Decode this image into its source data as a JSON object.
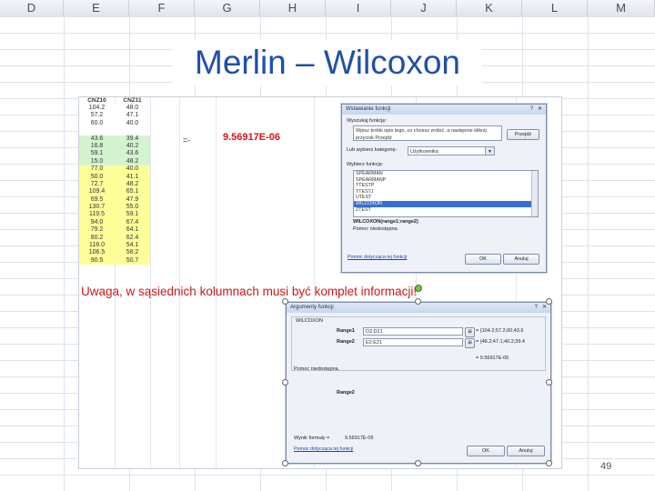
{
  "columns": [
    "D",
    "E",
    "F",
    "G",
    "H",
    "I",
    "J",
    "K",
    "L",
    "M"
  ],
  "title": "Merlin – Wilcoxon",
  "sheet": {
    "headers": [
      "CNZ10",
      "CNZ11"
    ],
    "rows": [
      [
        "104.2",
        "48.0"
      ],
      [
        "57.2",
        "47.1"
      ],
      [
        "60.0",
        "40.0"
      ],
      [
        "",
        ""
      ],
      [
        "43.6",
        "39.4"
      ],
      [
        "16.8",
        "40.2"
      ],
      [
        "59.1",
        "43.6"
      ],
      [
        "15.0",
        "48.2"
      ],
      [
        "77.0",
        "40.0"
      ],
      [
        "50.0",
        "41.1"
      ],
      [
        "72.7",
        "48.2"
      ],
      [
        "109.4",
        "65.1"
      ],
      [
        "69.5",
        "47.9"
      ],
      [
        "130.7",
        "55.0"
      ],
      [
        "119.5",
        "59.1"
      ],
      [
        "94.0",
        "67.4"
      ],
      [
        "79.2",
        "64.1"
      ],
      [
        "80.2",
        "62.4"
      ],
      [
        "118.0",
        "54.1"
      ],
      [
        "106.5",
        "58.2"
      ],
      [
        "90.5",
        "50.7"
      ]
    ],
    "arrow_text": "=-",
    "result_value": "9.56917E-06",
    "warning": "Uwaga, w sąsiednich kolumnach musi być komplet informacji!"
  },
  "dialog1": {
    "title": "Wstawianie funkcji",
    "search_label": "Wyszukaj funkcję:",
    "search_value": "Wpisz krótki opis tego, co chcesz zrobić, a następnie kliknij przycisk Przejdź",
    "go_button": "Przejdź",
    "category_label": "Lub wybierz kategorię:",
    "category_value": "Użytkownika",
    "select_label": "Wybierz funkcję:",
    "functions": [
      "SPEARMAN",
      "SPEARMANP",
      "TTESTP",
      "TTESTJ",
      "UTEST",
      "WILCOXON",
      "ZTEST"
    ],
    "selected_function": "WILCOXON",
    "signature": "WILCOXON(range1;range2)",
    "help_text": "Pomoc niedostępna.",
    "help_link": "Pomoc dotycząca tej funkcji",
    "ok": "OK",
    "cancel": "Anuluj"
  },
  "dialog2": {
    "title": "Argumenty funkcji",
    "group": "WILCOXON",
    "range1_label": "Range1",
    "range1_value": "D2:D21",
    "range1_preview": "= {104.2;57.2;60;43.6",
    "range2_label": "Range2",
    "range2_value": "E2:E21",
    "range2_preview": "= {48.2;47.1;40.2;39.4",
    "result_preview": "= 9.56917E-05",
    "help_text": "Pomoc niedostępna.",
    "arg_desc_label": "Range2",
    "formula_result_label": "Wynik formuły =",
    "formula_result_value": "9.56917E-05",
    "help_link": "Pomoc dotycząca tej funkcji",
    "ok": "OK",
    "cancel": "Anuluj"
  },
  "page_number": "49",
  "colors": {
    "title": "#1f4fa8",
    "warning": "#d0161b",
    "yellow": "#ffff99",
    "green": "#ccf2cc"
  }
}
